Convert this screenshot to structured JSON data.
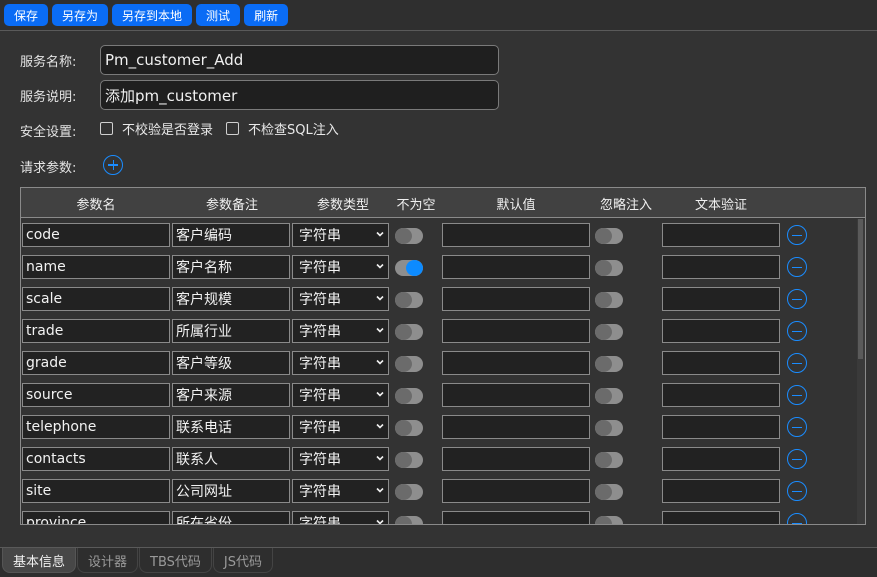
{
  "toolbar": {
    "buttons": [
      {
        "id": "save",
        "label": "保存"
      },
      {
        "id": "save-as",
        "label": "另存为"
      },
      {
        "id": "save-local",
        "label": "另存到本地"
      },
      {
        "id": "test",
        "label": "测试"
      },
      {
        "id": "refresh",
        "label": "刷新"
      }
    ]
  },
  "form": {
    "service_name_label": "服务名称:",
    "service_name_value": "Pm_customer_Add",
    "service_desc_label": "服务说明:",
    "service_desc_value": "添加pm_customer",
    "security_label": "安全设置:",
    "security_options": [
      {
        "label": "不校验是否登录",
        "checked": false
      },
      {
        "label": "不检查SQL注入",
        "checked": false
      }
    ],
    "request_params_label": "请求参数:",
    "add_param_icon": "plus-circle-icon"
  },
  "params_table": {
    "headers": [
      "参数名",
      "参数备注",
      "参数类型",
      "不为空",
      "默认值",
      "忽略注入",
      "文本验证"
    ],
    "rows": [
      {
        "name": "code",
        "note": "客户编码",
        "type": "字符串",
        "not_null": false,
        "default": "",
        "ignore_injection": false,
        "validation": ""
      },
      {
        "name": "name",
        "note": "客户名称",
        "type": "字符串",
        "not_null": true,
        "default": "",
        "ignore_injection": false,
        "validation": ""
      },
      {
        "name": "scale",
        "note": "客户规模",
        "type": "字符串",
        "not_null": false,
        "default": "",
        "ignore_injection": false,
        "validation": ""
      },
      {
        "name": "trade",
        "note": "所属行业",
        "type": "字符串",
        "not_null": false,
        "default": "",
        "ignore_injection": false,
        "validation": ""
      },
      {
        "name": "grade",
        "note": "客户等级",
        "type": "字符串",
        "not_null": false,
        "default": "",
        "ignore_injection": false,
        "validation": ""
      },
      {
        "name": "source",
        "note": "客户来源",
        "type": "字符串",
        "not_null": false,
        "default": "",
        "ignore_injection": false,
        "validation": ""
      },
      {
        "name": "telephone",
        "note": "联系电话",
        "type": "字符串",
        "not_null": false,
        "default": "",
        "ignore_injection": false,
        "validation": ""
      },
      {
        "name": "contacts",
        "note": "联系人",
        "type": "字符串",
        "not_null": false,
        "default": "",
        "ignore_injection": false,
        "validation": ""
      },
      {
        "name": "site",
        "note": "公司网址",
        "type": "字符串",
        "not_null": false,
        "default": "",
        "ignore_injection": false,
        "validation": ""
      },
      {
        "name": "province",
        "note": "所在省份",
        "type": "字符串",
        "not_null": false,
        "default": "",
        "ignore_injection": false,
        "validation": ""
      }
    ]
  },
  "tabs": [
    {
      "label": "基本信息",
      "active": true
    },
    {
      "label": "设计器",
      "active": false
    },
    {
      "label": "TBS代码",
      "active": false
    },
    {
      "label": "JS代码",
      "active": false
    }
  ],
  "colors": {
    "accent": "#0a6cf5",
    "toggle_on": "#0d8bff",
    "icon_blue": "#1a8cff"
  }
}
